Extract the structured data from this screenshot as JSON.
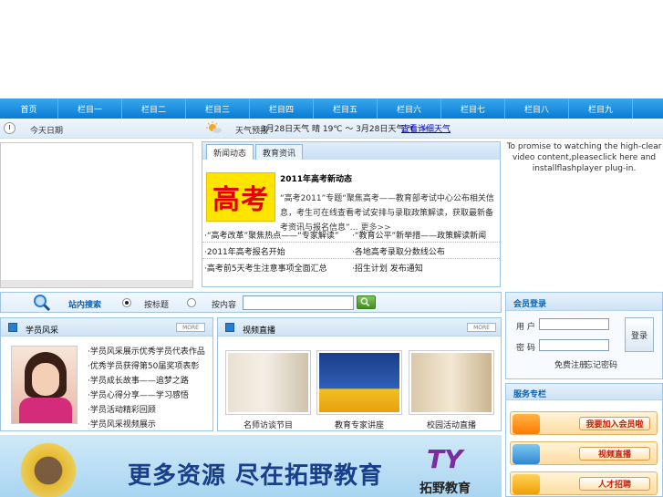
{
  "nav": {
    "items": [
      "首页",
      "栏目一",
      "栏目二",
      "栏目三",
      "栏目四",
      "栏目五",
      "栏目六",
      "栏目七",
      "栏目八",
      "栏目九"
    ]
  },
  "info_bar": {
    "date": "今天日期",
    "weather_label": "天气预报",
    "weather_text": "3月28日天气 晴 19℃ ～ 3月28日天气 ℃ ～",
    "weather_link": "查看详细天气"
  },
  "news": {
    "tabs": [
      "新闻动态",
      "教育资讯"
    ],
    "thumb_text": "高考",
    "headline": "2011年高考新动态",
    "summary": "“高考2011”专题“聚焦高考——教育部考试中心公布相关信息，考生可在线查看考试安排与录取政策解读，获取最新备考资讯与报名信息”…",
    "more": "更多>>",
    "links": [
      "·“高考改革”聚焦热点——“专家解读”",
      "·“教育公平”新举措——政策解读新闻",
      "·2011年高考报名开始",
      "·各地高考录取分数线公布",
      "·高考前5天考生注意事项全面汇总",
      "·招生计划 发布通知"
    ]
  },
  "flash_msg": "To promise to watching the high-clear video content,pleaseclick here and installflashplayer plug-in.",
  "search": {
    "label": "站内搜索",
    "option1": "按标题",
    "option2": "按内容",
    "placeholder": ""
  },
  "panel1": {
    "title": "学员风采",
    "more": "MORE",
    "items": [
      "·学员风采展示优秀学员代表作品",
      "·优秀学员获得第50届奖项表彰",
      "·学员成长故事——追梦之路",
      "·学员心得分享——学习感悟",
      "·学员活动精彩回顾",
      "·学员风采视频展示"
    ]
  },
  "panel2": {
    "title": "视频直播",
    "more": "MORE",
    "captions": [
      "名师访谈节目",
      "教育专家讲座",
      "校园活动直播"
    ]
  },
  "banner": {
    "slogan": "更多资源 尽在拓野教育",
    "logo_letters": "TY",
    "brand": "拓野教育"
  },
  "login": {
    "title": "会员登录",
    "user_label": "用 户",
    "pass_label": "密 码",
    "button": "登录",
    "register": "免费注册",
    "forgot": "忘记密码"
  },
  "service": {
    "title": "服务专栏",
    "buttons": [
      "我要加入会员啦",
      "视频直播",
      "人才招聘"
    ]
  },
  "colors": {
    "nav_blue": "#0a7cd6",
    "accent_text": "#0a63b0",
    "service_red": "#c0200a"
  }
}
